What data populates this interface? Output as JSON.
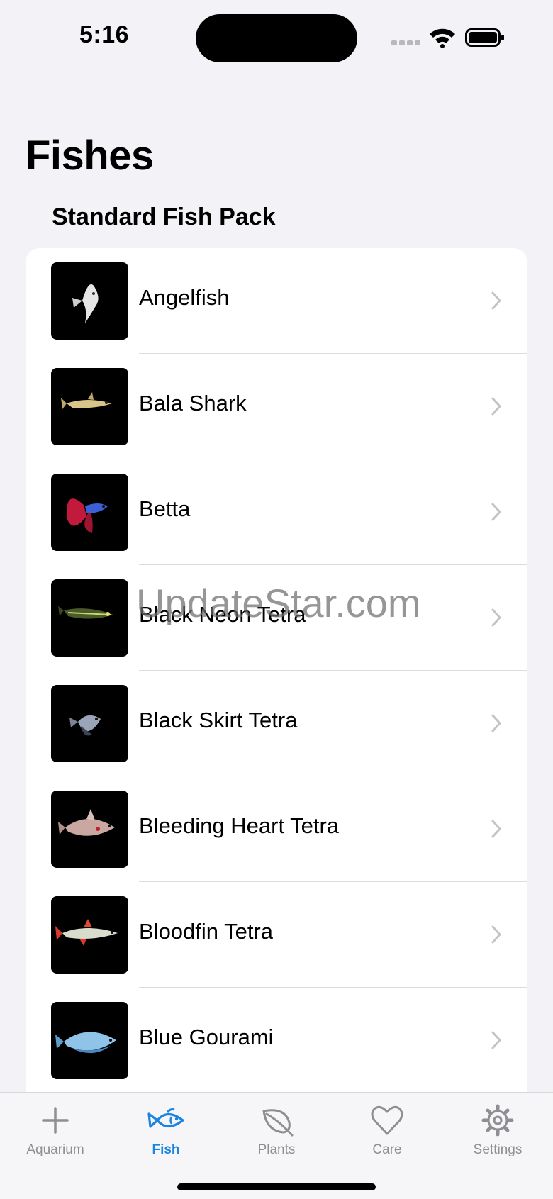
{
  "status_bar": {
    "time": "5:16"
  },
  "page": {
    "title": "Fishes",
    "section_header": "Standard Fish Pack"
  },
  "fish_list": [
    {
      "name": "Angelfish",
      "icon": "angelfish-thumbnail"
    },
    {
      "name": "Bala Shark",
      "icon": "bala-shark-thumbnail"
    },
    {
      "name": "Betta",
      "icon": "betta-thumbnail"
    },
    {
      "name": "Black Neon Tetra",
      "icon": "black-neon-tetra-thumbnail"
    },
    {
      "name": "Black Skirt Tetra",
      "icon": "black-skirt-tetra-thumbnail"
    },
    {
      "name": "Bleeding Heart Tetra",
      "icon": "bleeding-heart-tetra-thumbnail"
    },
    {
      "name": "Bloodfin Tetra",
      "icon": "bloodfin-tetra-thumbnail"
    },
    {
      "name": "Blue Gourami",
      "icon": "blue-gourami-thumbnail"
    }
  ],
  "watermark": "UpdateStar.com",
  "tab_bar": {
    "tabs": [
      {
        "label": "Aquarium",
        "icon": "plus-icon"
      },
      {
        "label": "Fish",
        "icon": "fish-icon",
        "active": true
      },
      {
        "label": "Plants",
        "icon": "leaf-icon"
      },
      {
        "label": "Care",
        "icon": "heart-icon"
      },
      {
        "label": "Settings",
        "icon": "gear-icon"
      }
    ]
  },
  "colors": {
    "background": "#f2f2f7",
    "card": "#ffffff",
    "accent": "#1a84e0",
    "inactive": "#8e8e93",
    "chevron": "#c4c4c8"
  }
}
